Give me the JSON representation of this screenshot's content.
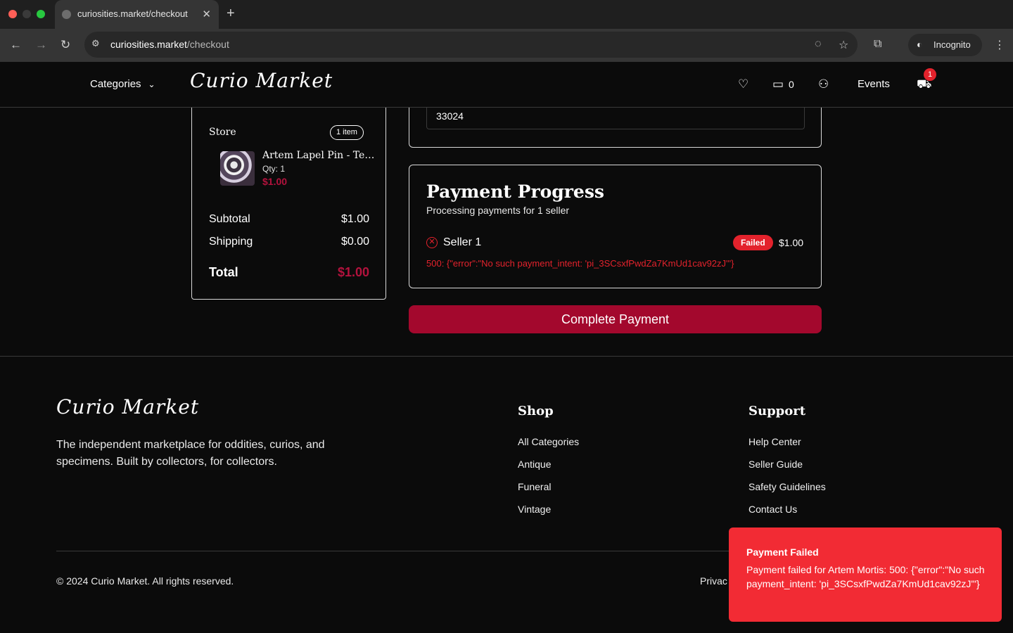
{
  "browser": {
    "tab_title": "curiosities.market/checkout",
    "new_tab": "+",
    "url_domain": "curiosities.market",
    "url_path": "/checkout",
    "incognito_label": "Incognito",
    "traffic_colors": [
      "#ff5f57",
      "#3a3a3a",
      "#28c840"
    ]
  },
  "header": {
    "categories_label": "Categories",
    "logo_text": "Curio Market",
    "messages_count": "0",
    "events_label": "Events",
    "cart_count": "1"
  },
  "order_summary": {
    "store_label": "Store",
    "item_count": "1 item",
    "product_name": "Artem Lapel Pin - Tes...",
    "product_qty": "Qty: 1",
    "product_price": "$1.00",
    "subtotal_label": "Subtotal",
    "subtotal_value": "$1.00",
    "shipping_label": "Shipping",
    "shipping_value": "$0.00",
    "total_label": "Total",
    "total_value": "$1.00"
  },
  "address": {
    "zip_value": "33024"
  },
  "payment": {
    "title": "Payment Progress",
    "subtitle": "Processing payments for 1 seller",
    "seller_name": "Seller 1",
    "status": "Failed",
    "amount": "$1.00",
    "error": "500: {\"error\":\"No such payment_intent: 'pi_3SCsxfPwdZa7KmUd1cav92zJ'\"}",
    "complete_button": "Complete Payment"
  },
  "footer": {
    "logo_text": "Curio Market",
    "tagline": "The independent marketplace for oddities, curios, and specimens. Built by collectors, for collectors.",
    "shop_heading": "Shop",
    "shop_links": [
      "All Categories",
      "Antique",
      "Funeral",
      "Vintage"
    ],
    "support_heading": "Support",
    "support_links": [
      "Help Center",
      "Seller Guide",
      "Safety Guidelines",
      "Contact Us"
    ],
    "copyright": "© 2024 Curio Market. All rights reserved.",
    "privacy_partial": "Privac"
  },
  "toast": {
    "title": "Payment Failed",
    "message": "Payment failed for Artem Mortis: 500: {\"error\":\"No such payment_intent: 'pi_3SCsxfPwdZa7KmUd1cav92zJ'\"}"
  },
  "colors": {
    "accent": "#a3082d",
    "price": "#b3123d",
    "error": "#e3222c",
    "toast": "#f22b34"
  }
}
